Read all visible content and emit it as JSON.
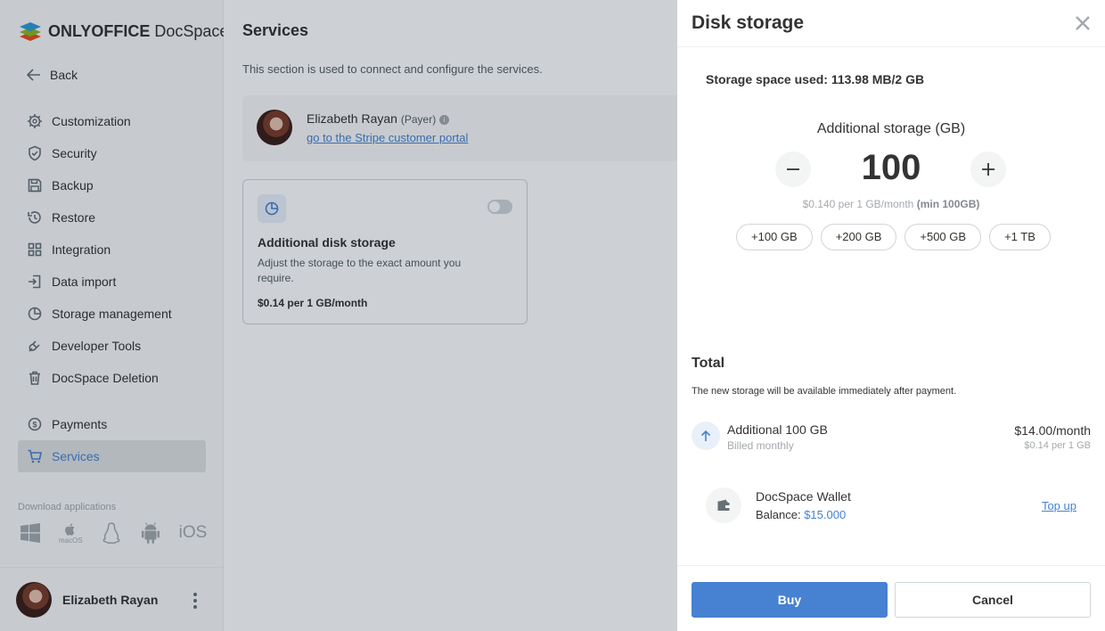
{
  "app": {
    "brand_bold": "ONLYOFFICE",
    "brand_regular": " DocSpace"
  },
  "sidebar": {
    "back_label": "Back",
    "items": [
      {
        "label": "Customization",
        "icon": "gear-icon"
      },
      {
        "label": "Security",
        "icon": "shield-icon"
      },
      {
        "label": "Backup",
        "icon": "floppy-icon"
      },
      {
        "label": "Restore",
        "icon": "restore-icon"
      },
      {
        "label": "Integration",
        "icon": "grid-icon"
      },
      {
        "label": "Data import",
        "icon": "import-icon"
      },
      {
        "label": "Storage management",
        "icon": "pie-chart-icon"
      },
      {
        "label": "Developer Tools",
        "icon": "plug-icon"
      },
      {
        "label": "DocSpace Deletion",
        "icon": "trash-icon"
      },
      {
        "label": "Payments",
        "icon": "dollar-icon"
      },
      {
        "label": "Services",
        "icon": "cart-icon",
        "active": true
      }
    ],
    "download_title": "Download applications",
    "apps": [
      "windows-icon",
      "macos-icon",
      "linux-icon",
      "android-icon",
      "ios-icon"
    ],
    "macos_label": "macOS",
    "ios_label": "iOS",
    "profile_name": "Elizabeth Rayan"
  },
  "main": {
    "title": "Services",
    "description": "This section is used to connect and configure the services.",
    "payer": {
      "name": "Elizabeth Rayan",
      "role": "(Payer)",
      "link": "go to the Stripe customer portal"
    },
    "service_card": {
      "title": "Additional disk storage",
      "description": "Adjust the storage to the exact amount you require.",
      "price": "$0.14 per 1 GB/month",
      "enabled": false
    }
  },
  "panel": {
    "title": "Disk storage",
    "storage_used": "Storage space used: 113.98 MB/2 GB",
    "additional_title": "Additional storage (GB)",
    "amount": "100",
    "price_note": "$0.140 per 1 GB/month",
    "price_min": "(min 100GB)",
    "chips": [
      "+100 GB",
      "+200 GB",
      "+500 GB",
      "+1 TB"
    ],
    "total_title": "Total",
    "total_desc": "The new storage will be available immediately after payment.",
    "line": {
      "label": "Additional 100 GB",
      "sub": "Billed monthly",
      "price": "$14.00/month",
      "price_sub": "$0.14 per 1 GB"
    },
    "wallet": {
      "label": "DocSpace Wallet",
      "balance_label": "Balance: ",
      "balance_value": "$15.000",
      "topup": "Top up"
    },
    "buy_label": "Buy",
    "cancel_label": "Cancel"
  },
  "colors": {
    "accent": "#4781d1",
    "sidebar_bg": "#f8f9f9",
    "active_bg": "#dfe2e3"
  }
}
